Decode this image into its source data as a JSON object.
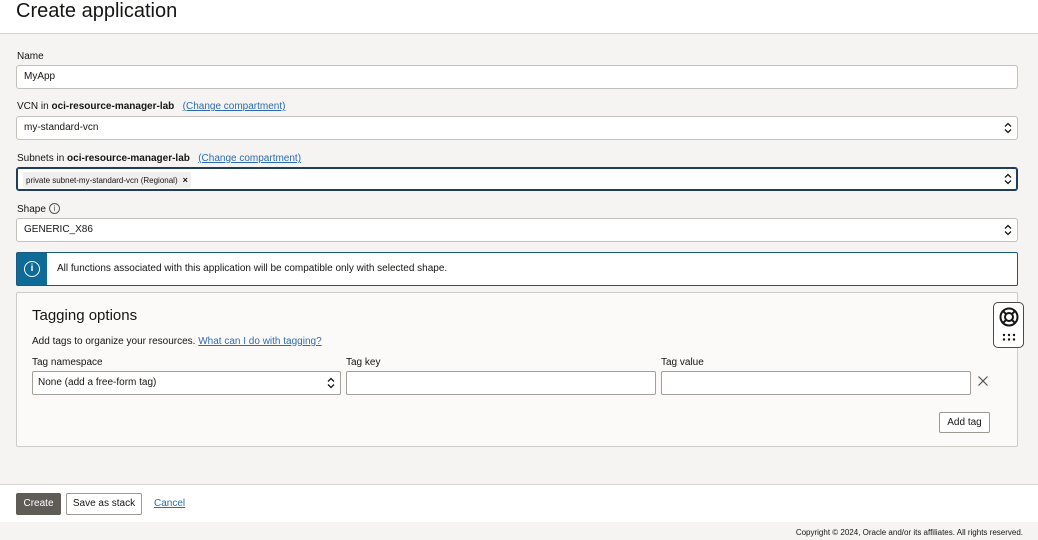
{
  "header": {
    "title": "Create application"
  },
  "form": {
    "name": {
      "label": "Name",
      "value": "MyApp"
    },
    "vcn": {
      "label_prefix": "VCN in",
      "compartment": "oci-resource-manager-lab",
      "change_link": "(Change compartment)",
      "value": "my-standard-vcn"
    },
    "subnets": {
      "label_prefix": "Subnets in",
      "compartment": "oci-resource-manager-lab",
      "change_link": "(Change compartment)",
      "chip": "private subnet-my-standard-vcn (Regional)",
      "chip_remove": "×"
    },
    "shape": {
      "label": "Shape",
      "info_icon": "i",
      "value": "GENERIC_X86"
    },
    "banner": {
      "icon": "i",
      "text": "All functions associated with this application will be compatible only with selected shape."
    }
  },
  "tagging": {
    "title": "Tagging options",
    "description": "Add tags to organize your resources.",
    "help_link": "What can I do with tagging?",
    "namespace_label": "Tag namespace",
    "namespace_value": "None (add a free-form tag)",
    "key_label": "Tag key",
    "key_value": "",
    "value_label": "Tag value",
    "value_value": "",
    "add_tag_label": "Add tag"
  },
  "footer": {
    "create_label": "Create",
    "save_stack_label": "Save as stack",
    "cancel_label": "Cancel"
  },
  "copyright": "Copyright © 2024, Oracle and/or its affiliates. All rights reserved.",
  "icons": {
    "select": "chevron-up-down-icon",
    "info": "info-icon",
    "remove": "close-icon",
    "help": "lifebuoy-icon",
    "menu": "dots-grid-icon"
  },
  "colors": {
    "primary_button": "#5f5b57",
    "banner_accent": "#0e6a96",
    "link": "#2b6cb0"
  }
}
